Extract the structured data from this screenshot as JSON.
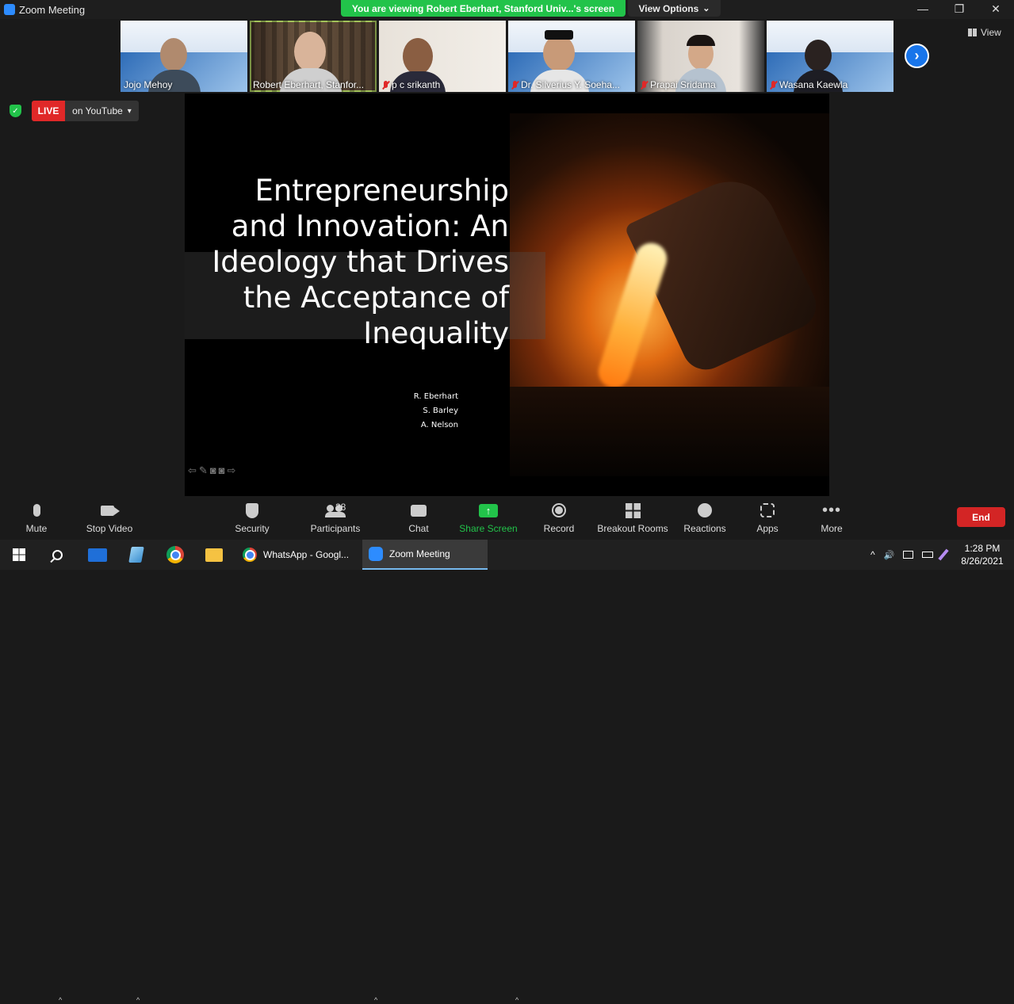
{
  "window": {
    "title": "Zoom Meeting",
    "minimize": "—",
    "maximize": "❐",
    "close": "✕"
  },
  "share_banner": {
    "text": "You are viewing Robert Eberhart, Stanford Univ...'s screen",
    "view_options": "View Options",
    "view_options_caret": "⌄"
  },
  "participants_strip": [
    {
      "name": "Jojo Mehoy",
      "muted": false
    },
    {
      "name": "Robert Eberhart, Stanfor...",
      "muted": false
    },
    {
      "name": "p c srikanth",
      "muted": true
    },
    {
      "name": "Dr. Silverius Y. Soeha...",
      "muted": true
    },
    {
      "name": "Prapai Sridama",
      "muted": true
    },
    {
      "name": "Wasana Kaewla",
      "muted": true
    }
  ],
  "strip_next": "›",
  "view_label": "View",
  "live": {
    "badge": "LIVE",
    "destination": "on YouTube",
    "caret": "▾",
    "shield": "✓"
  },
  "slide": {
    "title_lines": [
      "Entrepreneurship",
      "and Innovation: An",
      "Ideology that Drives",
      "the Acceptance of",
      "Inequality"
    ],
    "authors": [
      "R. Eberhart",
      "S. Barley",
      "A. Nelson"
    ],
    "nav_glyphs": [
      "⇦",
      "✎",
      "◙",
      "◙",
      "⇨"
    ]
  },
  "toolbar": {
    "mute": "Mute",
    "stop_video": "Stop Video",
    "security": "Security",
    "participants": "Participants",
    "participants_count": "28",
    "chat": "Chat",
    "share_screen": "Share Screen",
    "share_arrow": "↑",
    "record": "Record",
    "breakout_rooms": "Breakout Rooms",
    "reactions": "Reactions",
    "apps": "Apps",
    "more": "More",
    "more_dots": "•••",
    "caret": "^",
    "end": "End"
  },
  "taskbar": {
    "apps": [
      {
        "label": "WhatsApp - Googl...",
        "active": false
      },
      {
        "label": "Zoom Meeting",
        "active": true
      }
    ],
    "tray_chevron": "^",
    "tray_volume": "🔊",
    "time": "1:28 PM",
    "date": "8/26/2021"
  },
  "colors": {
    "share_green": "#22c34a",
    "live_red": "#e02828",
    "end_red": "#d32525",
    "zoom_blue": "#2d8cff",
    "active_speaker": "#a3c25a"
  }
}
